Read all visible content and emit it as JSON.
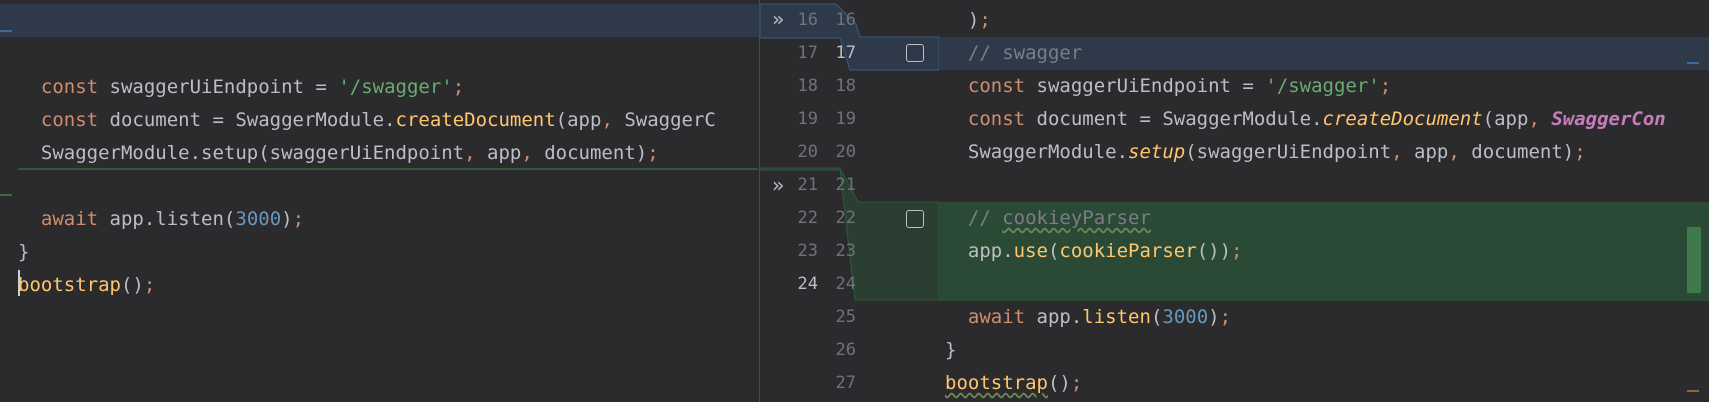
{
  "left": {
    "lines": [
      {
        "tokens": []
      },
      {
        "tokens": [
          {
            "t": "  "
          },
          {
            "t": "const",
            "c": "kw"
          },
          {
            "t": " swaggerUiEndpoint = "
          },
          {
            "t": "'/swagger'",
            "c": "str"
          },
          {
            "t": ";",
            "c": "kw"
          }
        ]
      },
      {
        "tokens": [
          {
            "t": "  "
          },
          {
            "t": "const",
            "c": "kw"
          },
          {
            "t": " document = SwaggerModule."
          },
          {
            "t": "createDocument",
            "c": "fn"
          },
          {
            "t": "(app"
          },
          {
            "t": ",",
            "c": "kw"
          },
          {
            "t": " SwaggerC"
          }
        ]
      },
      {
        "tokens": [
          {
            "t": "  SwaggerModule.setup(swaggerUiEndpoint"
          },
          {
            "t": ",",
            "c": "kw"
          },
          {
            "t": " app"
          },
          {
            "t": ",",
            "c": "kw"
          },
          {
            "t": " document)"
          },
          {
            "t": ";",
            "c": "kw"
          }
        ]
      },
      {
        "tokens": []
      },
      {
        "tokens": [
          {
            "t": "  "
          },
          {
            "t": "await",
            "c": "kw"
          },
          {
            "t": " app.listen("
          },
          {
            "t": "3000",
            "c": "num"
          },
          {
            "t": ")"
          },
          {
            "t": ";",
            "c": "kw"
          }
        ]
      },
      {
        "tokens": [
          {
            "t": "}"
          }
        ]
      },
      {
        "tokens": [
          {
            "t": "bootstrap",
            "c": "fn"
          },
          {
            "t": "()"
          },
          {
            "t": ";",
            "c": "kw"
          }
        ]
      }
    ]
  },
  "gutter": {
    "left_numbers": [
      "16",
      "17",
      "18",
      "19",
      "20",
      "21",
      "22",
      "23",
      "24"
    ],
    "right_numbers": [
      "16",
      "17",
      "18",
      "19",
      "20",
      "21",
      "22",
      "23",
      "24",
      "25",
      "26",
      "27"
    ],
    "chevron_icon": "»"
  },
  "right": {
    "lines": [
      {
        "tokens": [
          {
            "t": "  )"
          },
          {
            "t": ";",
            "c": "kw"
          }
        ]
      },
      {
        "tokens": [
          {
            "t": "  "
          },
          {
            "t": "// swagger",
            "c": "cm"
          }
        ]
      },
      {
        "tokens": [
          {
            "t": "  "
          },
          {
            "t": "const",
            "c": "kw"
          },
          {
            "t": " swaggerUiEndpoint = "
          },
          {
            "t": "'/swagger'",
            "c": "str"
          },
          {
            "t": ";",
            "c": "kw"
          }
        ]
      },
      {
        "tokens": [
          {
            "t": "  "
          },
          {
            "t": "const",
            "c": "kw"
          },
          {
            "t": " document = SwaggerModule."
          },
          {
            "t": "createDocument",
            "c": "fni"
          },
          {
            "t": "(app"
          },
          {
            "t": ",",
            "c": "kw"
          },
          {
            "t": " "
          },
          {
            "t": "SwaggerCon",
            "c": "pu"
          }
        ]
      },
      {
        "tokens": [
          {
            "t": "  SwaggerModule."
          },
          {
            "t": "setup",
            "c": "fni"
          },
          {
            "t": "(swaggerUiEndpoint"
          },
          {
            "t": ",",
            "c": "kw"
          },
          {
            "t": " app"
          },
          {
            "t": ",",
            "c": "kw"
          },
          {
            "t": " document)"
          },
          {
            "t": ";",
            "c": "kw"
          }
        ]
      },
      {
        "tokens": []
      },
      {
        "tokens": [
          {
            "t": "  "
          },
          {
            "t": "// ",
            "c": "cm"
          },
          {
            "t": "cookieyParser",
            "c": "cm wavy"
          }
        ]
      },
      {
        "tokens": [
          {
            "t": "  app."
          },
          {
            "t": "use",
            "c": "fn"
          },
          {
            "t": "("
          },
          {
            "t": "cookieParser",
            "c": "fn"
          },
          {
            "t": "())"
          },
          {
            "t": ";",
            "c": "kw"
          }
        ]
      },
      {
        "tokens": []
      },
      {
        "tokens": [
          {
            "t": "  "
          },
          {
            "t": "await",
            "c": "kw"
          },
          {
            "t": " app."
          },
          {
            "t": "listen",
            "c": "fn"
          },
          {
            "t": "("
          },
          {
            "t": "3000",
            "c": "num"
          },
          {
            "t": ")"
          },
          {
            "t": ";",
            "c": "kw"
          }
        ]
      },
      {
        "tokens": [
          {
            "t": "}"
          }
        ]
      },
      {
        "tokens": [
          {
            "t": "bootstrap",
            "c": "fn wavy"
          },
          {
            "t": "()"
          },
          {
            "t": ";",
            "c": "kw"
          }
        ]
      }
    ]
  }
}
